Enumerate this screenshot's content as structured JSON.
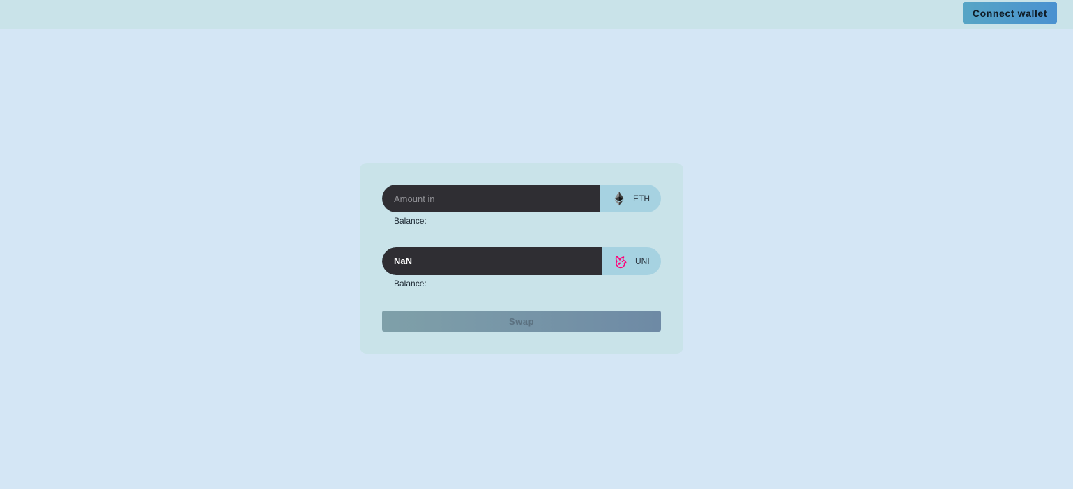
{
  "header": {
    "connect_wallet_label": "Connect wallet"
  },
  "swap": {
    "input": {
      "placeholder": "Amount in",
      "value": "",
      "token_symbol": "ETH",
      "token_icon": "ethereum-icon",
      "balance_label": "Balance:"
    },
    "output": {
      "value": "NaN",
      "token_symbol": "UNI",
      "token_icon": "uniswap-icon",
      "balance_label": "Balance:"
    },
    "swap_label": "Swap",
    "swap_disabled": true
  },
  "colors": {
    "page_background": "#d4e6f5",
    "topbar_background": "#c9e3e9",
    "card_background": "#c9e3e9",
    "input_dark": "#2f2e33",
    "token_pill": "#a6d2e1",
    "connect_button": "#4a9bcc",
    "uni_accent": "#ff007a"
  }
}
